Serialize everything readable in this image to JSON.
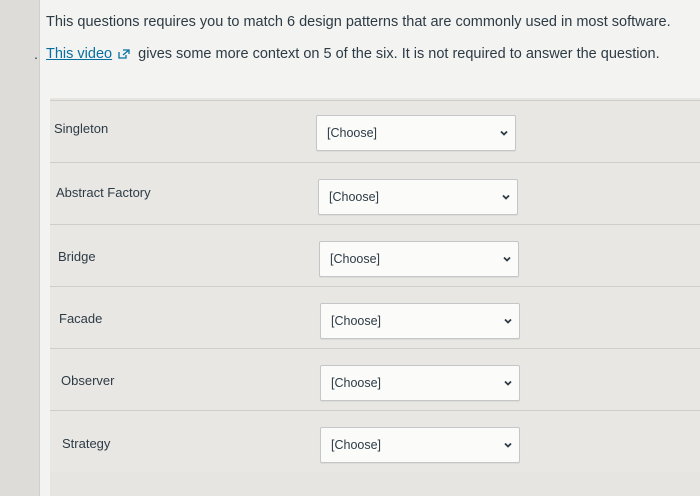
{
  "question": {
    "intro_text": "This questions requires you to match 6 design patterns that are commonly used in most software.",
    "bullet": ".",
    "video_link_text": "This video",
    "video_rest_text": "gives some more context on 5 of the six. It is not required to answer the question."
  },
  "matches": [
    {
      "label": "Singleton",
      "selected": "[Choose]"
    },
    {
      "label": "Abstract Factory",
      "selected": "[Choose]"
    },
    {
      "label": "Bridge",
      "selected": "[Choose]"
    },
    {
      "label": "Facade",
      "selected": "[Choose]"
    },
    {
      "label": "Observer",
      "selected": "[Choose]"
    },
    {
      "label": "Strategy",
      "selected": "[Choose]"
    }
  ],
  "icons": {
    "external_link": "external-link-icon",
    "dropdown": "chevron-down-icon"
  },
  "colors": {
    "link": "#0770a3",
    "text": "#2d3b45"
  }
}
